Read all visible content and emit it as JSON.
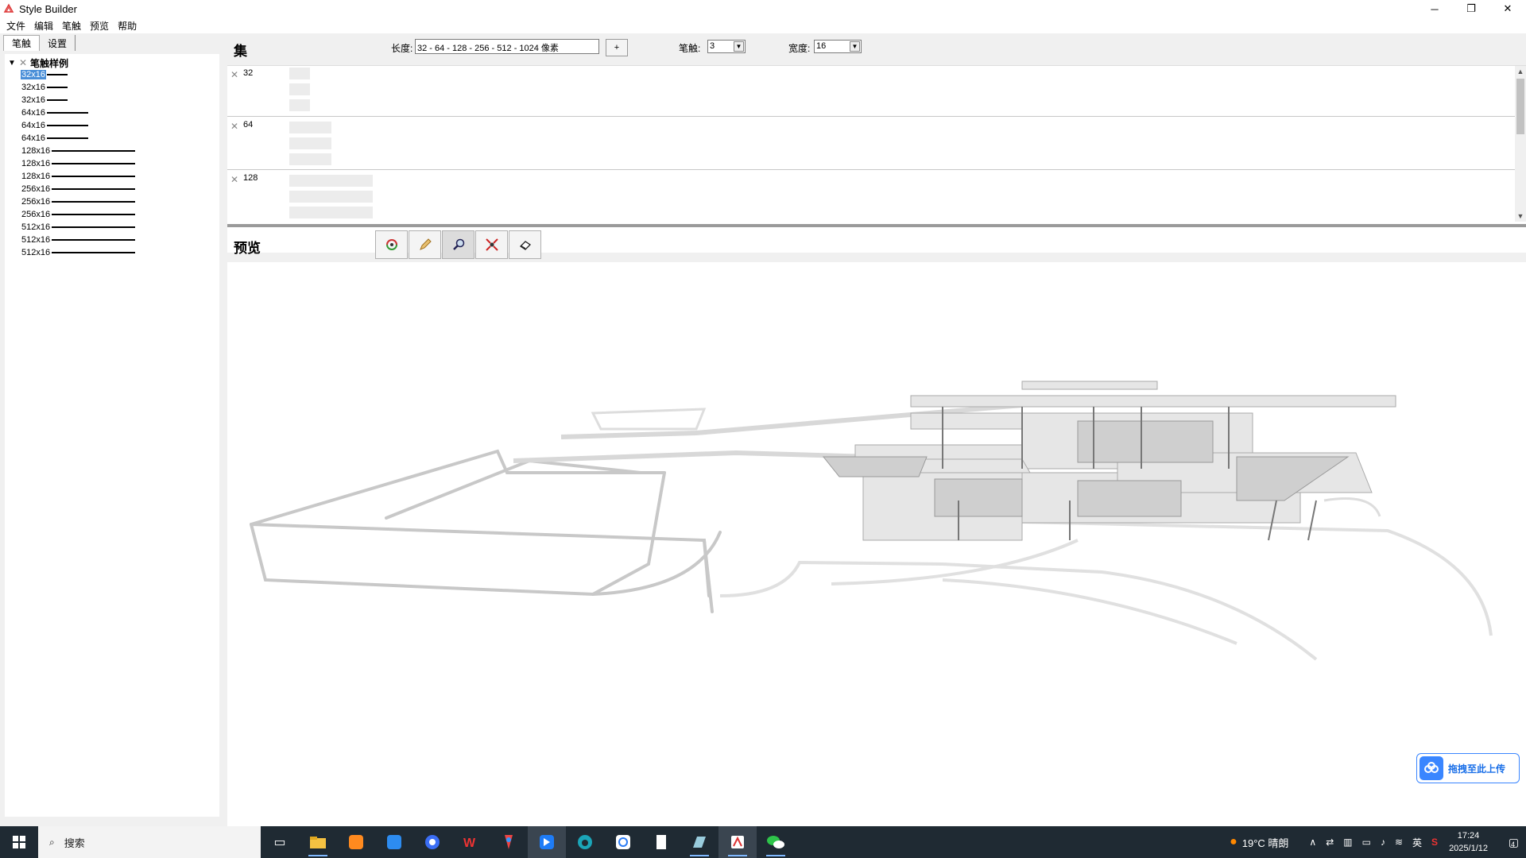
{
  "window": {
    "title": "Style Builder",
    "controls": [
      "─",
      "❐",
      "✕"
    ]
  },
  "menu": [
    "文件",
    "编辑",
    "笔触",
    "预览",
    "帮助"
  ],
  "left_tabs": [
    "笔触",
    "设置"
  ],
  "tree": {
    "root_label": "笔触样例",
    "items": [
      {
        "label": "32x16",
        "len": 32
      },
      {
        "label": "32x16",
        "len": 32
      },
      {
        "label": "32x16",
        "len": 32
      },
      {
        "label": "64x16",
        "len": 64
      },
      {
        "label": "64x16",
        "len": 64
      },
      {
        "label": "64x16",
        "len": 64
      },
      {
        "label": "128x16",
        "len": 128
      },
      {
        "label": "128x16",
        "len": 128
      },
      {
        "label": "128x16",
        "len": 128
      },
      {
        "label": "256x16",
        "len": 128
      },
      {
        "label": "256x16",
        "len": 128
      },
      {
        "label": "256x16",
        "len": 128
      },
      {
        "label": "512x16",
        "len": 128
      },
      {
        "label": "512x16",
        "len": 128
      },
      {
        "label": "512x16",
        "len": 128
      }
    ]
  },
  "set_panel": {
    "title": "集",
    "length_label": "长度:",
    "length_value": "32 - 64 - 128 - 256 - 512 - 1024 像素",
    "plus_label": "+",
    "stroke_label": "笔触:",
    "stroke_value": "3",
    "width_label": "宽度:",
    "width_value": "16",
    "rows": [
      {
        "label": "32",
        "bar_len": 32
      },
      {
        "label": "64",
        "bar_len": 64
      },
      {
        "label": "128",
        "bar_len": 128
      }
    ]
  },
  "preview": {
    "title": "预览",
    "tools": [
      "orbit-icon",
      "pencil-icon",
      "zoom-icon",
      "zoom-extents-icon",
      "eraser-icon"
    ]
  },
  "upload_button": {
    "label": "拖拽至此上传"
  },
  "taskbar": {
    "search_placeholder": "搜索",
    "apps": [
      "file-explorer-icon",
      "store-icon",
      "mail-icon",
      "browser-icon",
      "wps-icon",
      "paint-icon",
      "feishu-icon",
      "edge-icon",
      "baidu-netdisk-icon",
      "notepad-icon",
      "sketch-icon",
      "sketchup-icon",
      "wechat-icon"
    ],
    "weather": "19°C  晴朗",
    "ime": "英",
    "time": "17:24",
    "date": "2025/1/12",
    "notif_count": "4"
  },
  "colors": {
    "selection": "#4a8fd8",
    "taskbar": "#1f2a33",
    "accent": "#3a86ff"
  }
}
